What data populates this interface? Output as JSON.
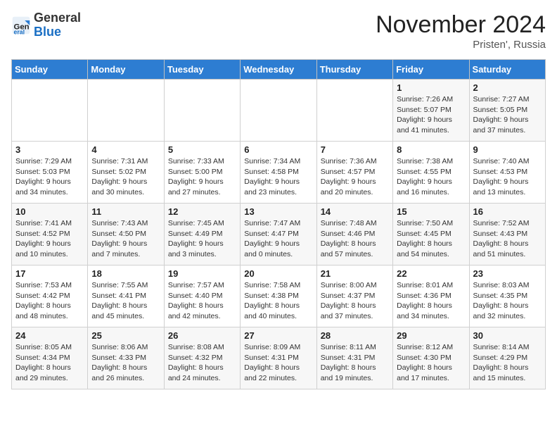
{
  "logo": {
    "general": "General",
    "blue": "Blue"
  },
  "title": "November 2024",
  "location": "Pristen', Russia",
  "days_of_week": [
    "Sunday",
    "Monday",
    "Tuesday",
    "Wednesday",
    "Thursday",
    "Friday",
    "Saturday"
  ],
  "weeks": [
    [
      {
        "day": "",
        "info": ""
      },
      {
        "day": "",
        "info": ""
      },
      {
        "day": "",
        "info": ""
      },
      {
        "day": "",
        "info": ""
      },
      {
        "day": "",
        "info": ""
      },
      {
        "day": "1",
        "info": "Sunrise: 7:26 AM\nSunset: 5:07 PM\nDaylight: 9 hours and 41 minutes."
      },
      {
        "day": "2",
        "info": "Sunrise: 7:27 AM\nSunset: 5:05 PM\nDaylight: 9 hours and 37 minutes."
      }
    ],
    [
      {
        "day": "3",
        "info": "Sunrise: 7:29 AM\nSunset: 5:03 PM\nDaylight: 9 hours and 34 minutes."
      },
      {
        "day": "4",
        "info": "Sunrise: 7:31 AM\nSunset: 5:02 PM\nDaylight: 9 hours and 30 minutes."
      },
      {
        "day": "5",
        "info": "Sunrise: 7:33 AM\nSunset: 5:00 PM\nDaylight: 9 hours and 27 minutes."
      },
      {
        "day": "6",
        "info": "Sunrise: 7:34 AM\nSunset: 4:58 PM\nDaylight: 9 hours and 23 minutes."
      },
      {
        "day": "7",
        "info": "Sunrise: 7:36 AM\nSunset: 4:57 PM\nDaylight: 9 hours and 20 minutes."
      },
      {
        "day": "8",
        "info": "Sunrise: 7:38 AM\nSunset: 4:55 PM\nDaylight: 9 hours and 16 minutes."
      },
      {
        "day": "9",
        "info": "Sunrise: 7:40 AM\nSunset: 4:53 PM\nDaylight: 9 hours and 13 minutes."
      }
    ],
    [
      {
        "day": "10",
        "info": "Sunrise: 7:41 AM\nSunset: 4:52 PM\nDaylight: 9 hours and 10 minutes."
      },
      {
        "day": "11",
        "info": "Sunrise: 7:43 AM\nSunset: 4:50 PM\nDaylight: 9 hours and 7 minutes."
      },
      {
        "day": "12",
        "info": "Sunrise: 7:45 AM\nSunset: 4:49 PM\nDaylight: 9 hours and 3 minutes."
      },
      {
        "day": "13",
        "info": "Sunrise: 7:47 AM\nSunset: 4:47 PM\nDaylight: 9 hours and 0 minutes."
      },
      {
        "day": "14",
        "info": "Sunrise: 7:48 AM\nSunset: 4:46 PM\nDaylight: 8 hours and 57 minutes."
      },
      {
        "day": "15",
        "info": "Sunrise: 7:50 AM\nSunset: 4:45 PM\nDaylight: 8 hours and 54 minutes."
      },
      {
        "day": "16",
        "info": "Sunrise: 7:52 AM\nSunset: 4:43 PM\nDaylight: 8 hours and 51 minutes."
      }
    ],
    [
      {
        "day": "17",
        "info": "Sunrise: 7:53 AM\nSunset: 4:42 PM\nDaylight: 8 hours and 48 minutes."
      },
      {
        "day": "18",
        "info": "Sunrise: 7:55 AM\nSunset: 4:41 PM\nDaylight: 8 hours and 45 minutes."
      },
      {
        "day": "19",
        "info": "Sunrise: 7:57 AM\nSunset: 4:40 PM\nDaylight: 8 hours and 42 minutes."
      },
      {
        "day": "20",
        "info": "Sunrise: 7:58 AM\nSunset: 4:38 PM\nDaylight: 8 hours and 40 minutes."
      },
      {
        "day": "21",
        "info": "Sunrise: 8:00 AM\nSunset: 4:37 PM\nDaylight: 8 hours and 37 minutes."
      },
      {
        "day": "22",
        "info": "Sunrise: 8:01 AM\nSunset: 4:36 PM\nDaylight: 8 hours and 34 minutes."
      },
      {
        "day": "23",
        "info": "Sunrise: 8:03 AM\nSunset: 4:35 PM\nDaylight: 8 hours and 32 minutes."
      }
    ],
    [
      {
        "day": "24",
        "info": "Sunrise: 8:05 AM\nSunset: 4:34 PM\nDaylight: 8 hours and 29 minutes."
      },
      {
        "day": "25",
        "info": "Sunrise: 8:06 AM\nSunset: 4:33 PM\nDaylight: 8 hours and 26 minutes."
      },
      {
        "day": "26",
        "info": "Sunrise: 8:08 AM\nSunset: 4:32 PM\nDaylight: 8 hours and 24 minutes."
      },
      {
        "day": "27",
        "info": "Sunrise: 8:09 AM\nSunset: 4:31 PM\nDaylight: 8 hours and 22 minutes."
      },
      {
        "day": "28",
        "info": "Sunrise: 8:11 AM\nSunset: 4:31 PM\nDaylight: 8 hours and 19 minutes."
      },
      {
        "day": "29",
        "info": "Sunrise: 8:12 AM\nSunset: 4:30 PM\nDaylight: 8 hours and 17 minutes."
      },
      {
        "day": "30",
        "info": "Sunrise: 8:14 AM\nSunset: 4:29 PM\nDaylight: 8 hours and 15 minutes."
      }
    ]
  ]
}
